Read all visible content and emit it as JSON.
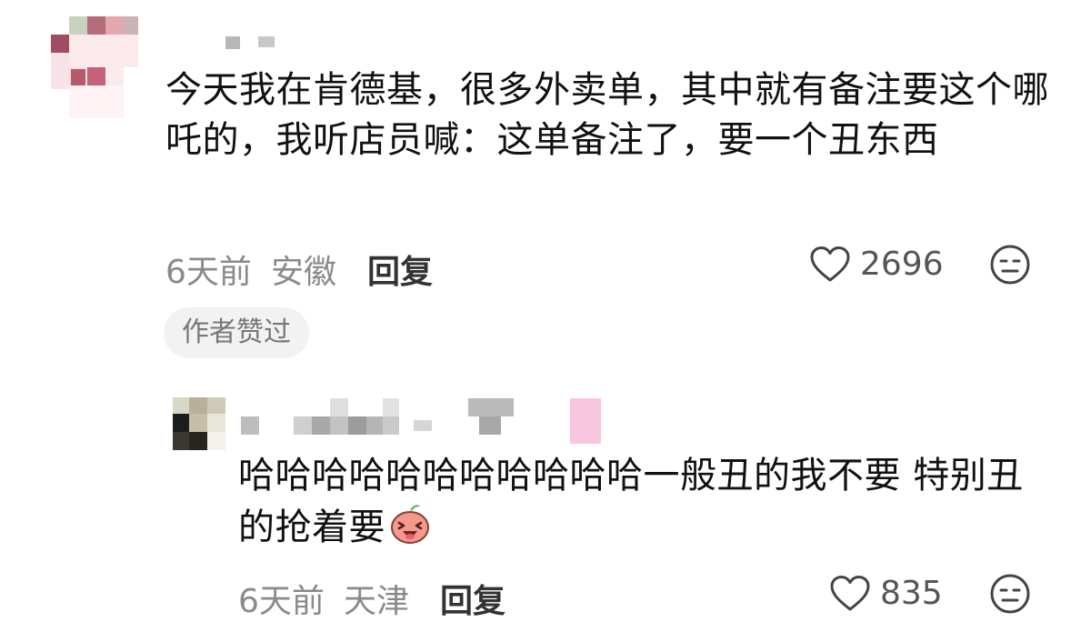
{
  "comments": [
    {
      "text": "今天我在肯德基，很多外卖单，其中就有备注要这个哪吒的，我听店员喊：这单备注了，要一个丑东西",
      "time": "6天前",
      "location": "安徽",
      "reply_label": "回复",
      "likes": "2696",
      "badge": "作者赞过"
    },
    {
      "text": "哈哈哈哈哈哈哈哈哈哈哈一般丑的我不要 特别丑的抢着要",
      "emoji": "laughing-blob-emoji",
      "time": "6天前",
      "location": "天津",
      "reply_label": "回复",
      "likes": "835"
    }
  ],
  "icons": {
    "like": "heart-outline-icon",
    "dislike": "meh-face-icon"
  }
}
